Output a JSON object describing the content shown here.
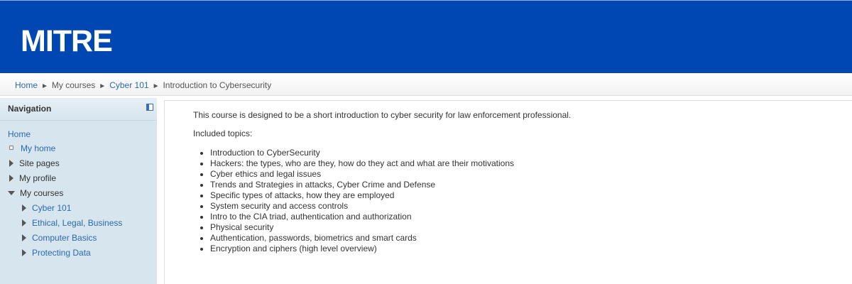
{
  "header": {
    "logo_text": "MITRE"
  },
  "breadcrumb": {
    "items": [
      {
        "label": "Home",
        "link": true
      },
      {
        "label": "My courses",
        "link": false
      },
      {
        "label": "Cyber 101",
        "link": true
      },
      {
        "label": "Introduction to Cybersecurity",
        "link": false
      }
    ],
    "separator": "►"
  },
  "navigation": {
    "title": "Navigation",
    "home": "Home",
    "my_home": "My home",
    "site_pages": "Site pages",
    "my_profile": "My profile",
    "my_courses": "My courses",
    "courses": [
      "Cyber 101",
      "Ethical, Legal, Business",
      "Computer Basics",
      "Protecting Data"
    ]
  },
  "content": {
    "intro": "This course is designed to be a short introduction to cyber security for law enforcement professional.",
    "included_label": "Included topics:",
    "topics": [
      "Introduction to CyberSecurity",
      "Hackers: the types, who are they, how do they act and what are their motivations",
      "Cyber ethics and legal issues",
      "Trends and Strategies in attacks, Cyber Crime and Defense",
      "Specific types of attacks, how they are employed",
      "System security and access controls",
      "Intro to the CIA triad, authentication and authorization",
      "Physical security",
      "Authentication, passwords, biometrics and smart cards",
      "Encryption and ciphers (high level overview)"
    ]
  },
  "colors": {
    "header_bg": "#0047b3",
    "link": "#2a6ab0",
    "sidebar_bg": "#d7e5ee"
  }
}
